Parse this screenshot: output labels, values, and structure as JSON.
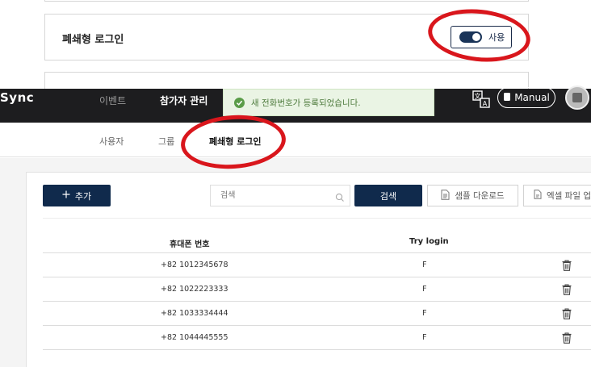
{
  "settings": {
    "closed_login_title": "폐쇄형 로그인",
    "toggle_label": "사용",
    "toggle_on": true
  },
  "app": {
    "logo": "Sync",
    "nav": [
      {
        "label": "이벤트"
      },
      {
        "label": "참가자 관리"
      }
    ],
    "manual_label": "Manual"
  },
  "toast": {
    "message": "새 전화번호가 등록되었습니다."
  },
  "subtabs": [
    {
      "label": "사용자"
    },
    {
      "label": "그룹"
    },
    {
      "label": "폐쇄형 로그인"
    }
  ],
  "toolbar": {
    "add_label": "추가",
    "search_placeholder": "검색",
    "search_button": "검색",
    "sample_download": "샘플 다운로드",
    "excel_upload": "엑셀 파일 업로드"
  },
  "table": {
    "headers": [
      "휴대폰 번호",
      "Try login"
    ],
    "rows": [
      {
        "phone": "+82 1012345678",
        "try_login": "F"
      },
      {
        "phone": "+82 1022223333",
        "try_login": "F"
      },
      {
        "phone": "+82 1033334444",
        "try_login": "F"
      },
      {
        "phone": "+82 1044445555",
        "try_login": "F"
      }
    ]
  },
  "colors": {
    "primary": "#102a4c",
    "annotation": "#d9161c",
    "toast_bg": "#eaf4e4",
    "header_bg": "#1d1d1f"
  }
}
